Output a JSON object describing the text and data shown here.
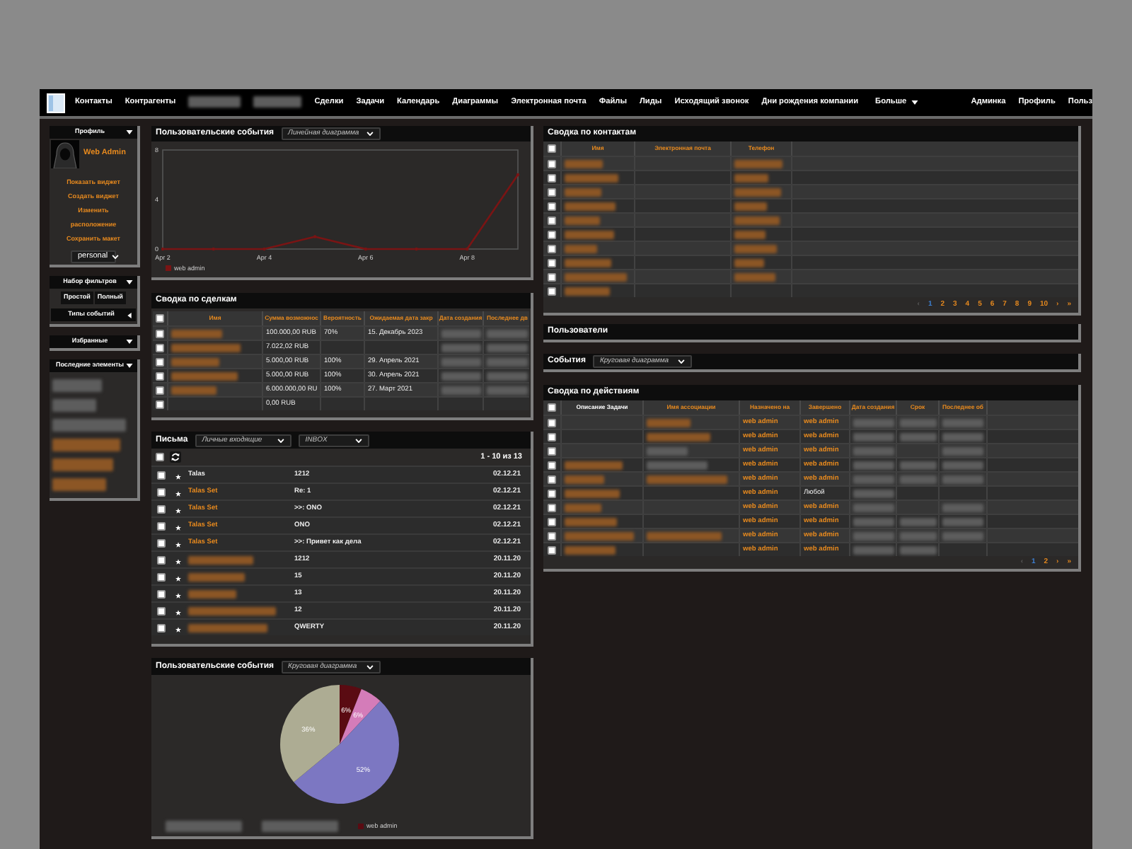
{
  "nav": {
    "items": [
      {
        "kind": "link",
        "label": "Контакты"
      },
      {
        "kind": "link",
        "label": "Контрагенты"
      },
      {
        "kind": "blurred"
      },
      {
        "kind": "blurred"
      },
      {
        "kind": "link",
        "label": "Сделки"
      },
      {
        "kind": "link",
        "label": "Задачи"
      },
      {
        "kind": "link",
        "label": "Календарь"
      },
      {
        "kind": "link",
        "label": "Диаграммы"
      },
      {
        "kind": "link",
        "label": "Электронная почта"
      },
      {
        "kind": "link",
        "label": "Файлы"
      },
      {
        "kind": "link",
        "label": "Лиды"
      },
      {
        "kind": "link",
        "label": "Исходящий звонок"
      },
      {
        "kind": "link",
        "label": "Дни рождения компании"
      },
      {
        "kind": "dropdown",
        "label": "Больше"
      }
    ],
    "right_items": [
      "Админка",
      "Профиль",
      "Польз"
    ]
  },
  "sidebar": {
    "profile": {
      "title": "Профиль",
      "expanded": true,
      "user": "Web Admin",
      "links": [
        "Показать виджет",
        "Создать виджет",
        "Изменить расположение",
        "Сохранить макет"
      ],
      "layout_select": "personal"
    },
    "filters": {
      "title": "Набор фильтров",
      "expanded": true,
      "buttons": [
        "Простой",
        "Полный"
      ],
      "event_types": {
        "label": "Типы событий",
        "expanded": false
      }
    },
    "favorites": {
      "title": "Избранные",
      "expanded": true
    },
    "recent": {
      "title": "Последние элементы",
      "expanded": true,
      "items": [
        {
          "kind": "blurred",
          "link": false
        },
        {
          "kind": "blurred",
          "link": false
        },
        {
          "kind": "blurred",
          "link": false
        },
        {
          "kind": "blurred",
          "link": true
        },
        {
          "kind": "blurred",
          "link": true
        },
        {
          "kind": "blurred",
          "link": true
        }
      ]
    }
  },
  "activity_chart": {
    "title": "Пользовательские события",
    "chart_select": "Линейная диаграмма",
    "chart_data": {
      "type": "line",
      "categories": [
        "Apr 2",
        null,
        "Apr 4",
        null,
        "Apr 6",
        null,
        "Apr 8",
        null
      ],
      "ylim": [
        0,
        8
      ],
      "yticks": [
        0,
        4,
        8
      ],
      "series": [
        {
          "name": "web admin",
          "color": "#7a1414",
          "values": [
            0,
            0,
            0,
            1,
            0,
            0,
            0,
            6
          ]
        }
      ]
    }
  },
  "deals": {
    "title": "Сводка по сделкам",
    "all_checked": false,
    "columns": [
      {
        "label": "Имя",
        "sortable": true
      },
      {
        "label": "Сумма возможнос",
        "sortable": true
      },
      {
        "label": "Вероятность",
        "sortable": true
      },
      {
        "label": "Ожидаемая дата закр",
        "sortable": true
      },
      {
        "label": "Дата создания",
        "sortable": true
      },
      {
        "label": "Последнее дв",
        "sortable": true
      }
    ],
    "rows": [
      {
        "checked": false,
        "cells": [
          {
            "kind": "blurred",
            "link": true
          },
          "100.000,00 RUB",
          "70%",
          "15. Декабрь 2023",
          {
            "kind": "blurred",
            "link": false
          },
          {
            "kind": "blurred",
            "link": false
          }
        ]
      },
      {
        "checked": false,
        "cells": [
          {
            "kind": "blurred",
            "link": true
          },
          "7.022,02 RUB",
          null,
          null,
          {
            "kind": "blurred",
            "link": false
          },
          {
            "kind": "blurred",
            "link": false
          }
        ]
      },
      {
        "checked": false,
        "cells": [
          {
            "kind": "blurred",
            "link": true
          },
          "5.000,00 RUB",
          "100%",
          "29. Апрель 2021",
          {
            "kind": "blurred",
            "link": false
          },
          {
            "kind": "blurred",
            "link": false
          }
        ]
      },
      {
        "checked": false,
        "cells": [
          {
            "kind": "blurred",
            "link": true
          },
          "5.000,00 RUB",
          "100%",
          "30. Апрель 2021",
          {
            "kind": "blurred",
            "link": false
          },
          {
            "kind": "blurred",
            "link": false
          }
        ]
      },
      {
        "checked": false,
        "cells": [
          {
            "kind": "blurred",
            "link": true
          },
          "6.000.000,00 RU",
          "100%",
          "27. Март 2021",
          {
            "kind": "blurred",
            "link": false
          },
          {
            "kind": "blurred",
            "link": false
          }
        ]
      },
      {
        "checked": false,
        "cells": [
          null,
          "0,00 RUB",
          null,
          null,
          null,
          null
        ]
      }
    ]
  },
  "mail": {
    "title": "Письма",
    "folder_select": "Личные входящие",
    "mailbox_select": "INBOX",
    "all_checked": false,
    "count": "1 - 10 из 13",
    "rows": [
      {
        "checked": false,
        "sender": "Talas",
        "subject": "1212",
        "date": "02.12.21"
      },
      {
        "checked": false,
        "sender": {
          "kind": "link",
          "text": "Talas Set"
        },
        "subject": "Re: 1",
        "date": "02.12.21"
      },
      {
        "checked": false,
        "sender": {
          "kind": "link",
          "text": "Talas Set"
        },
        "subject": ">>: ONO",
        "date": "02.12.21"
      },
      {
        "checked": false,
        "sender": {
          "kind": "link",
          "text": "Talas Set"
        },
        "subject": "ONO",
        "date": "02.12.21"
      },
      {
        "checked": false,
        "sender": {
          "kind": "link",
          "text": "Talas Set"
        },
        "subject": ">>: Привет как дела",
        "date": "02.12.21"
      },
      {
        "checked": false,
        "sender": {
          "kind": "blurred",
          "link": true
        },
        "subject": "1212",
        "date": "20.11.20"
      },
      {
        "checked": false,
        "sender": {
          "kind": "blurred",
          "link": true
        },
        "subject": "15",
        "date": "20.11.20"
      },
      {
        "checked": false,
        "sender": {
          "kind": "blurred",
          "link": true
        },
        "subject": "13",
        "date": "20.11.20"
      },
      {
        "checked": false,
        "sender": {
          "kind": "blurred",
          "link": true
        },
        "subject": "12",
        "date": "20.11.20"
      },
      {
        "checked": false,
        "sender": {
          "kind": "blurred",
          "link": true
        },
        "subject": "QWERTY",
        "date": "20.11.20"
      }
    ]
  },
  "events_pie": {
    "title": "Пользовательские события",
    "chart_select": "Круговая диаграмма",
    "chart_data": {
      "type": "pie",
      "values": [
        6,
        6,
        52,
        36
      ],
      "value_labels": [
        "6%",
        "6%",
        "52%",
        "36%"
      ],
      "colors": [
        "#5a0b12",
        "#d47cb9",
        "#7c77c2",
        "#adac93"
      ]
    },
    "legend": [
      {
        "kind": "blurred"
      },
      {
        "kind": "blurred"
      },
      {
        "kind": "entry",
        "label": "web admin",
        "color": "#5a0b12"
      }
    ]
  },
  "contacts": {
    "title": "Сводка по контактам",
    "all_checked": false,
    "columns": [
      {
        "label": "Имя",
        "sortable": true
      },
      {
        "label": "Электронная почта",
        "sortable": true
      },
      {
        "label": "Телефон",
        "sortable": true
      }
    ],
    "rows": [
      {
        "checked": false,
        "cells": [
          {
            "kind": "blurred",
            "link": true
          },
          null,
          {
            "kind": "blurred",
            "link": true
          }
        ]
      },
      {
        "checked": false,
        "cells": [
          {
            "kind": "blurred",
            "link": true
          },
          null,
          {
            "kind": "blurred",
            "link": true
          }
        ]
      },
      {
        "checked": false,
        "cells": [
          {
            "kind": "blurred",
            "link": true
          },
          null,
          {
            "kind": "blurred",
            "link": true
          }
        ]
      },
      {
        "checked": false,
        "cells": [
          {
            "kind": "blurred",
            "link": true
          },
          null,
          {
            "kind": "blurred",
            "link": true
          }
        ]
      },
      {
        "checked": false,
        "cells": [
          {
            "kind": "blurred",
            "link": true
          },
          null,
          {
            "kind": "blurred",
            "link": true
          }
        ]
      },
      {
        "checked": false,
        "cells": [
          {
            "kind": "blurred",
            "link": true
          },
          null,
          {
            "kind": "blurred",
            "link": true
          }
        ]
      },
      {
        "checked": false,
        "cells": [
          {
            "kind": "blurred",
            "link": true
          },
          null,
          {
            "kind": "blurred",
            "link": true
          }
        ]
      },
      {
        "checked": false,
        "cells": [
          {
            "kind": "blurred",
            "link": true
          },
          null,
          {
            "kind": "blurred",
            "link": true
          }
        ]
      },
      {
        "checked": false,
        "cells": [
          {
            "kind": "blurred",
            "link": true
          },
          null,
          {
            "kind": "blurred",
            "link": true
          }
        ]
      },
      {
        "checked": false,
        "cells": [
          {
            "kind": "blurred",
            "link": true
          },
          null,
          null
        ]
      }
    ],
    "pagination": {
      "prev": {
        "label": "‹",
        "disabled": true
      },
      "pages": [
        {
          "label": "1",
          "selected": true
        },
        {
          "label": "2",
          "selected": false
        },
        {
          "label": "3",
          "selected": false
        },
        {
          "label": "4",
          "selected": false
        },
        {
          "label": "5",
          "selected": false
        },
        {
          "label": "6",
          "selected": false
        },
        {
          "label": "7",
          "selected": false
        },
        {
          "label": "8",
          "selected": false
        },
        {
          "label": "9",
          "selected": false
        },
        {
          "label": "10",
          "selected": false
        }
      ],
      "next": {
        "label": "›",
        "disabled": false
      },
      "last": {
        "label": "»",
        "disabled": false
      }
    }
  },
  "users": {
    "title": "Пользователи"
  },
  "events": {
    "title": "События",
    "chart_select": "Круговая диаграмма"
  },
  "actions": {
    "title": "Сводка по действиям",
    "all_checked": false,
    "columns": [
      {
        "label": "Описание Задачи",
        "sortable": false
      },
      {
        "label": "Имя ассоциации",
        "sortable": true
      },
      {
        "label": "Назначено на",
        "sortable": true
      },
      {
        "label": "Завершено",
        "sortable": true
      },
      {
        "label": "Дата создания",
        "sortable": true
      },
      {
        "label": "Срок",
        "sortable": true
      },
      {
        "label": "Последнее об",
        "sortable": true
      }
    ],
    "rows": [
      {
        "checked": false,
        "cells": [
          null,
          {
            "kind": "blurred",
            "link": true
          },
          {
            "kind": "link",
            "text": "web admin"
          },
          {
            "kind": "link",
            "text": "web admin"
          },
          {
            "kind": "blurred",
            "link": false
          },
          {
            "kind": "blurred",
            "link": false
          },
          {
            "kind": "blurred",
            "link": false
          }
        ]
      },
      {
        "checked": false,
        "cells": [
          null,
          {
            "kind": "blurred",
            "link": true
          },
          {
            "kind": "link",
            "text": "web admin"
          },
          {
            "kind": "link",
            "text": "web admin"
          },
          {
            "kind": "blurred",
            "link": false
          },
          {
            "kind": "blurred",
            "link": false
          },
          {
            "kind": "blurred",
            "link": false
          }
        ]
      },
      {
        "checked": false,
        "cells": [
          null,
          {
            "kind": "blurred",
            "link": false
          },
          {
            "kind": "link",
            "text": "web admin"
          },
          {
            "kind": "link",
            "text": "web admin"
          },
          {
            "kind": "blurred",
            "link": false
          },
          null,
          {
            "kind": "blurred",
            "link": false
          }
        ]
      },
      {
        "checked": false,
        "cells": [
          {
            "kind": "blurred",
            "link": true
          },
          {
            "kind": "blurred",
            "link": false
          },
          {
            "kind": "link",
            "text": "web admin"
          },
          {
            "kind": "link",
            "text": "web admin"
          },
          {
            "kind": "blurred",
            "link": false
          },
          {
            "kind": "blurred",
            "link": false
          },
          {
            "kind": "blurred",
            "link": false
          }
        ]
      },
      {
        "checked": false,
        "cells": [
          {
            "kind": "blurred",
            "link": true
          },
          {
            "kind": "blurred",
            "link": true
          },
          {
            "kind": "link",
            "text": "web admin"
          },
          {
            "kind": "link",
            "text": "web admin"
          },
          {
            "kind": "blurred",
            "link": false
          },
          {
            "kind": "blurred",
            "link": false
          },
          {
            "kind": "blurred",
            "link": false
          }
        ]
      },
      {
        "checked": false,
        "cells": [
          {
            "kind": "blurred",
            "link": true
          },
          null,
          {
            "kind": "link",
            "text": "web admin"
          },
          "Любой",
          {
            "kind": "blurred",
            "link": false
          },
          null,
          null
        ]
      },
      {
        "checked": false,
        "cells": [
          {
            "kind": "blurred",
            "link": true
          },
          null,
          {
            "kind": "link",
            "text": "web admin"
          },
          {
            "kind": "link",
            "text": "web admin"
          },
          {
            "kind": "blurred",
            "link": false
          },
          null,
          {
            "kind": "blurred",
            "link": false
          }
        ]
      },
      {
        "checked": false,
        "cells": [
          {
            "kind": "blurred",
            "link": true
          },
          null,
          {
            "kind": "link",
            "text": "web admin"
          },
          {
            "kind": "link",
            "text": "web admin"
          },
          {
            "kind": "blurred",
            "link": false
          },
          {
            "kind": "blurred",
            "link": false
          },
          {
            "kind": "blurred",
            "link": false
          }
        ]
      },
      {
        "checked": false,
        "cells": [
          {
            "kind": "blurred",
            "link": true
          },
          {
            "kind": "blurred",
            "link": true
          },
          {
            "kind": "link",
            "text": "web admin"
          },
          {
            "kind": "link",
            "text": "web admin"
          },
          {
            "kind": "blurred",
            "link": false
          },
          {
            "kind": "blurred",
            "link": false
          },
          {
            "kind": "blurred",
            "link": false
          }
        ]
      },
      {
        "checked": false,
        "cells": [
          {
            "kind": "blurred",
            "link": true
          },
          null,
          {
            "kind": "link",
            "text": "web admin"
          },
          {
            "kind": "link",
            "text": "web admin"
          },
          {
            "kind": "blurred",
            "link": false
          },
          {
            "kind": "blurred",
            "link": false
          },
          null
        ]
      }
    ],
    "pagination": {
      "prev": {
        "label": "‹",
        "disabled": true
      },
      "pages": [
        {
          "label": "1",
          "selected": true
        },
        {
          "label": "2",
          "selected": false
        }
      ],
      "next": {
        "label": "›",
        "disabled": false
      },
      "last": {
        "label": "»",
        "disabled": false
      }
    }
  }
}
